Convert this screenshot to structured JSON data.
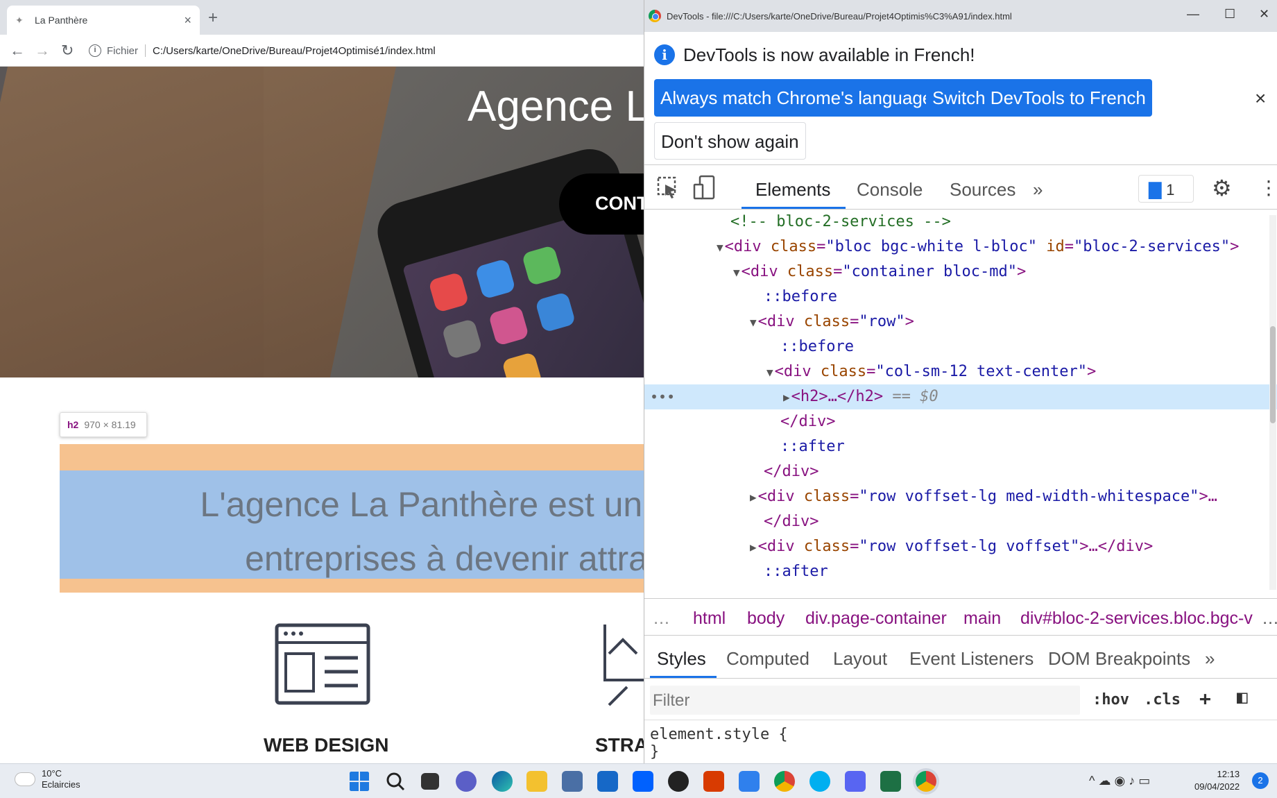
{
  "browser": {
    "tab_title": "La Panthère",
    "address_scheme": "Fichier",
    "address": "C:/Users/karte/OneDrive/Bureau/Projet4Optimisé1/index.html"
  },
  "page": {
    "hero_title": "Agence La",
    "cta_label": "CONT",
    "tooltip_tag": "h2",
    "tooltip_dims": "970 × 81.19",
    "h2_line1": "L'agence La Panthère est une ag",
    "h2_line2": "entreprises à devenir attrac",
    "services": [
      {
        "title": "WEB DESIGN"
      },
      {
        "title": "STRA"
      }
    ]
  },
  "devtools": {
    "window_title": "DevTools - file:///C:/Users/karte/OneDrive/Bureau/Projet4Optimis%C3%A91/index.html",
    "info_message": "DevTools is now available in French!",
    "btn_match": "Always match Chrome's language",
    "btn_switch": "Switch DevTools to French",
    "btn_dont_show": "Don't show again",
    "tabs": [
      "Elements",
      "Console",
      "Sources"
    ],
    "issues_count": "1",
    "tree": [
      {
        "text": "<!-- bloc-2-services -->"
      },
      {
        "tag": "<div",
        "attrs": [
          [
            "class",
            "\"bloc bgc-white l-bloc\""
          ],
          [
            "id",
            "\"bloc-2-services\""
          ]
        ],
        "end": ">"
      },
      {
        "tag": "<div",
        "attrs": [
          [
            "class",
            "\"container bloc-md\""
          ]
        ],
        "end": ">"
      },
      {
        "pseudo": "::before"
      },
      {
        "tag": "<div",
        "attrs": [
          [
            "class",
            "\"row\""
          ]
        ],
        "end": ">"
      },
      {
        "pseudo": "::before"
      },
      {
        "tag": "<div",
        "attrs": [
          [
            "class",
            "\"col-sm-12 text-center\""
          ]
        ],
        "end": ">"
      },
      {
        "sel_tag": "<h2>…</h2>",
        "sel_suffix": "== $0"
      },
      {
        "close": "</div>"
      },
      {
        "pseudo": "::after"
      },
      {
        "close": "</div>"
      },
      {
        "tag": "<div",
        "attrs": [
          [
            "class",
            "\"row voffset-lg med-width-whitespace\""
          ]
        ],
        "end": ">…"
      },
      {
        "close": "</div>"
      },
      {
        "tag": "<div",
        "attrs": [
          [
            "class",
            "\"row voffset-lg voffset\""
          ]
        ],
        "end": ">…</div>"
      },
      {
        "pseudo": "::after"
      }
    ],
    "breadcrumbs": [
      "html",
      "body",
      "div.page-container",
      "main",
      "div#bloc-2-services.bloc.bgc-v"
    ],
    "styles_tabs": [
      "Styles",
      "Computed",
      "Layout",
      "Event Listeners",
      "DOM Breakpoints"
    ],
    "filter_placeholder": "Filter",
    "hov": ":hov",
    "cls": ".cls",
    "rule_selector": "element.style {",
    "rule_close": "}"
  },
  "taskbar": {
    "temperature": "10°C",
    "weather": "Eclaircies",
    "time": "12:13",
    "date": "09/04/2022",
    "notifications": "2"
  }
}
